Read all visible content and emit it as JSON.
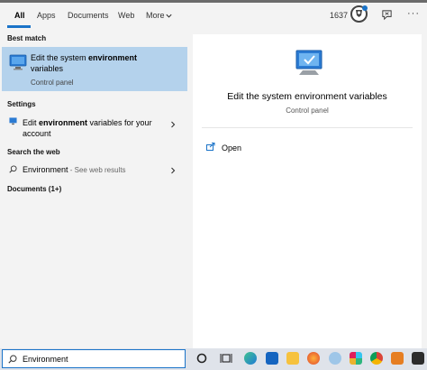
{
  "tabs": {
    "items": [
      {
        "label": "All",
        "selected": true
      },
      {
        "label": "Apps"
      },
      {
        "label": "Documents"
      },
      {
        "label": "Web"
      },
      {
        "label": "More"
      }
    ],
    "points": "1637"
  },
  "sections": {
    "best_match": "Best match",
    "settings": "Settings",
    "search_web": "Search the web",
    "documents": "Documents (1+)"
  },
  "best_match": {
    "title_pre": "Edit the system ",
    "title_bold": "environment",
    "title_post": " variables",
    "subtitle": "Control panel"
  },
  "settings_item": {
    "pre": "Edit ",
    "bold": "environment",
    "post": " variables for your account"
  },
  "web_item": {
    "query": "Environment",
    "hint": " - See web results"
  },
  "preview": {
    "title": "Edit the system environment variables",
    "subtitle": "Control panel",
    "action_open": "Open"
  },
  "taskbar": {
    "search_value": "Environment",
    "icons": [
      "cortana-icon",
      "task-view-icon",
      "edge-icon",
      "file-explorer-icon",
      "folder-icon",
      "firefox-icon",
      "app-icon",
      "slack-icon",
      "chrome-icon",
      "app2-icon",
      "app3-icon"
    ]
  },
  "colors": {
    "accent": "#1a73c8",
    "selected_bg": "#b4d2ec"
  }
}
